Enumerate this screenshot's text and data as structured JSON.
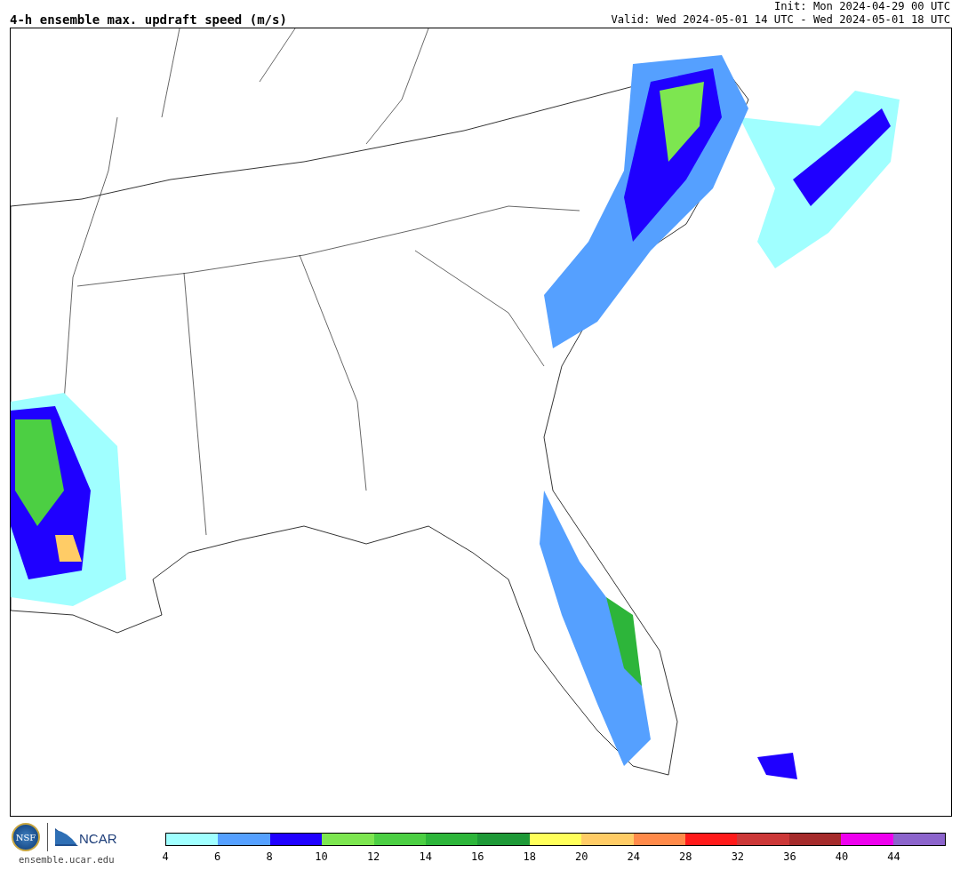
{
  "title": "4-h ensemble max. updraft speed (m/s)",
  "init": "Init: Mon 2024-04-29 00 UTC",
  "valid": "Valid: Wed 2024-05-01 14 UTC - Wed 2024-05-01 18 UTC",
  "logos": {
    "nsf": "NSF",
    "ncar": "NCAR",
    "site": "ensemble.ucar.edu"
  },
  "colorbar": {
    "bins": [
      {
        "color": "#a0ffff"
      },
      {
        "color": "#55a0ff"
      },
      {
        "color": "#1f00ff"
      },
      {
        "color": "#7de650"
      },
      {
        "color": "#4ccf43"
      },
      {
        "color": "#2db53a"
      },
      {
        "color": "#1e9937"
      },
      {
        "color": "#ffff5a"
      },
      {
        "color": "#ffcc66"
      },
      {
        "color": "#ff8a4a"
      },
      {
        "color": "#ff1a1a"
      },
      {
        "color": "#cc3838"
      },
      {
        "color": "#a52b2b"
      },
      {
        "color": "#ee00ee"
      },
      {
        "color": "#8c64cc"
      }
    ],
    "ticks": [
      "4",
      "6",
      "8",
      "10",
      "12",
      "14",
      "16",
      "18",
      "20",
      "24",
      "28",
      "32",
      "36",
      "40",
      "44"
    ]
  }
}
